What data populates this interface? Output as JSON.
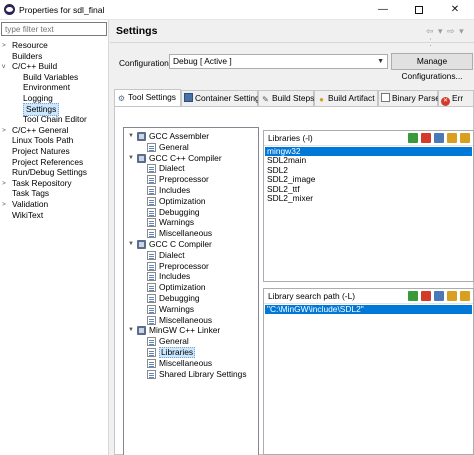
{
  "window": {
    "title": "Properties for sdl_final",
    "min": "—",
    "close": "✕"
  },
  "filter": {
    "placeholder": "type filter text"
  },
  "left_tree": [
    {
      "label": "Resource",
      "twisty": ">"
    },
    {
      "label": "Builders",
      "twisty": ""
    },
    {
      "label": "C/C++ Build",
      "twisty": "v"
    },
    {
      "label": "Build Variables",
      "twisty": ""
    },
    {
      "label": "Environment",
      "twisty": ""
    },
    {
      "label": "Logging",
      "twisty": ""
    },
    {
      "label": "Settings",
      "twisty": "",
      "selected": true
    },
    {
      "label": "Tool Chain Editor",
      "twisty": ""
    },
    {
      "label": "C/C++ General",
      "twisty": ">"
    },
    {
      "label": "Linux Tools Path",
      "twisty": ""
    },
    {
      "label": "Project Natures",
      "twisty": ""
    },
    {
      "label": "Project References",
      "twisty": ""
    },
    {
      "label": "Run/Debug Settings",
      "twisty": ""
    },
    {
      "label": "Task Repository",
      "twisty": ">"
    },
    {
      "label": "Task Tags",
      "twisty": ""
    },
    {
      "label": "Validation",
      "twisty": ">"
    },
    {
      "label": "WikiText",
      "twisty": ""
    }
  ],
  "settings": {
    "title": "Settings",
    "nav_icons": "⇦ ▾ ⇨ ▾ ⋮",
    "configuration_label": "Configuration:",
    "configuration_value": "Debug  [ Active ]",
    "dropdown_arrow": "▼",
    "manage_button": "Manage Configurations..."
  },
  "tabs": [
    {
      "label": "Tool Settings",
      "active": true
    },
    {
      "label": "Container Settings"
    },
    {
      "label": "Build Steps"
    },
    {
      "label": "Build Artifact"
    },
    {
      "label": "Binary Parsers"
    },
    {
      "label": "Err"
    }
  ],
  "tool_tree": [
    {
      "label": "GCC Assembler",
      "type": "tool"
    },
    {
      "label": "General",
      "type": "page"
    },
    {
      "label": "GCC C++ Compiler",
      "type": "tool"
    },
    {
      "label": "Dialect",
      "type": "page"
    },
    {
      "label": "Preprocessor",
      "type": "page"
    },
    {
      "label": "Includes",
      "type": "page"
    },
    {
      "label": "Optimization",
      "type": "page"
    },
    {
      "label": "Debugging",
      "type": "page"
    },
    {
      "label": "Warnings",
      "type": "page"
    },
    {
      "label": "Miscellaneous",
      "type": "page"
    },
    {
      "label": "GCC C Compiler",
      "type": "tool"
    },
    {
      "label": "Dialect",
      "type": "page"
    },
    {
      "label": "Preprocessor",
      "type": "page"
    },
    {
      "label": "Includes",
      "type": "page"
    },
    {
      "label": "Optimization",
      "type": "page"
    },
    {
      "label": "Debugging",
      "type": "page"
    },
    {
      "label": "Warnings",
      "type": "page"
    },
    {
      "label": "Miscellaneous",
      "type": "page"
    },
    {
      "label": "MinGW C++ Linker",
      "type": "tool"
    },
    {
      "label": "General",
      "type": "page"
    },
    {
      "label": "Libraries",
      "type": "page",
      "selected": true
    },
    {
      "label": "Miscellaneous",
      "type": "page"
    },
    {
      "label": "Shared Library Settings",
      "type": "page"
    }
  ],
  "libraries": {
    "header": "Libraries (-l)",
    "items": [
      "mingw32",
      "SDL2main",
      "SDL2",
      "SDL2_image",
      "SDL2_ttf",
      "SDL2_mixer"
    ]
  },
  "library_paths": {
    "header": "Library search path (-L)",
    "items": [
      "\"C:\\MinGW\\include\\SDL2\""
    ]
  },
  "icon_colors": {
    "add": "#3a9a3a",
    "delete": "#d23a2a",
    "edit": "#4a78b8",
    "move_up": "#d8a020",
    "move_down": "#d8a020"
  }
}
